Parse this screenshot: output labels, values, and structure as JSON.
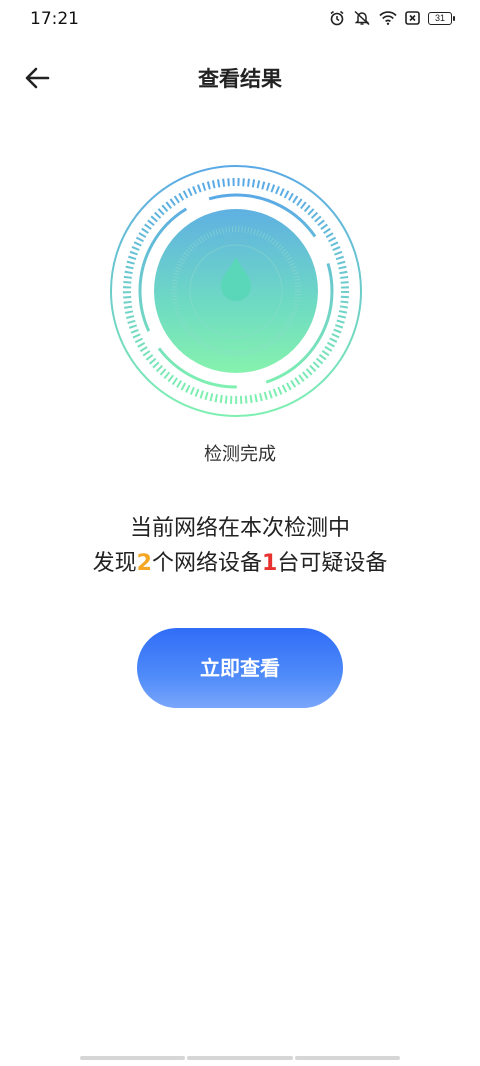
{
  "status_bar": {
    "time": "17:21",
    "battery": "31",
    "icons": [
      "alarm-icon",
      "mute-icon",
      "wifi-icon",
      "no-sim-icon",
      "battery-icon"
    ]
  },
  "header": {
    "title": "查看结果",
    "back_icon": "arrow-left-icon"
  },
  "scan": {
    "status": "检测完成",
    "icon": "water-drop-icon"
  },
  "summary": {
    "line1": "当前网络在本次检测中",
    "prefix": "发现",
    "device_count": "2",
    "middle": "个网络设备",
    "suspicious_count": "1",
    "suffix": "台可疑设备"
  },
  "actions": {
    "view_label": "立即查看"
  },
  "colors": {
    "accent_blue": "#2f6df7",
    "highlight_orange": "#f5a623",
    "highlight_red": "#e8322f",
    "radar_top": "#5aa9e6",
    "radar_bottom": "#7ff0b0"
  }
}
